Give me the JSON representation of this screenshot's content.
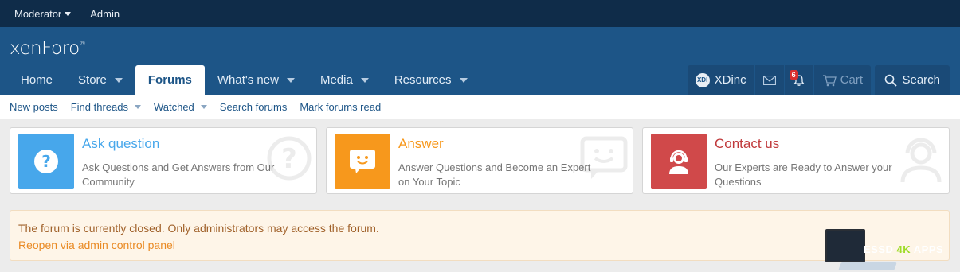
{
  "staffbar": {
    "moderator": "Moderator",
    "admin": "Admin"
  },
  "logo": {
    "text": "xenForo",
    "mark": "®"
  },
  "nav": {
    "tabs": [
      {
        "label": "Home"
      },
      {
        "label": "Store"
      },
      {
        "label": "Forums"
      },
      {
        "label": "What's new"
      },
      {
        "label": "Media"
      },
      {
        "label": "Resources"
      }
    ]
  },
  "account": {
    "avatar_text": "XDI",
    "username": "XDinc",
    "notification_count": "6",
    "cart": "Cart"
  },
  "search": {
    "label": "Search"
  },
  "subnav": {
    "items": [
      {
        "label": "New posts"
      },
      {
        "label": "Find threads"
      },
      {
        "label": "Watched"
      },
      {
        "label": "Search forums"
      },
      {
        "label": "Mark forums read"
      }
    ]
  },
  "cards": [
    {
      "title": "Ask question",
      "desc": "Ask Questions and Get Answers from Our Community",
      "color": "#47a7eb",
      "icon": "question-icon"
    },
    {
      "title": "Answer",
      "desc": "Answer Questions and Become an Expert on Your Topic",
      "color": "#f7981c",
      "icon": "speech-bubble-icon"
    },
    {
      "title": "Contact us",
      "desc": "Our Experts are Ready to Answer your Questions",
      "color": "#d0494a",
      "icon": "support-agent-icon"
    }
  ],
  "notice": {
    "text": "The forum is currently closed. Only administrators may access the forum.",
    "link": "Reopen via admin control panel"
  },
  "watermark": {
    "part1": "ESSD ",
    "part2": "4K",
    "part3": " APPS"
  },
  "colors": {
    "staffbar": "#0f2c49",
    "header": "#1d5587",
    "accent": "#1d5587"
  }
}
